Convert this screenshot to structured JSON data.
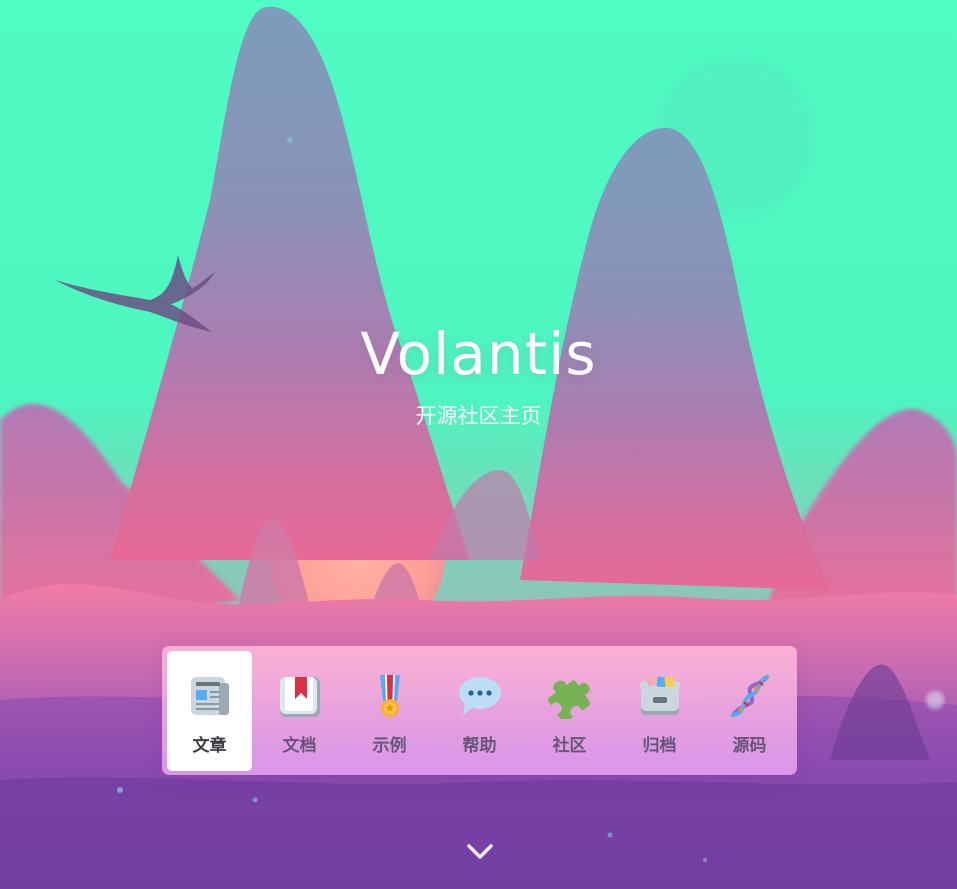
{
  "hero": {
    "title": "Volantis",
    "subtitle": "开源社区主页"
  },
  "nav": {
    "active_index": 0,
    "items": [
      {
        "label": "文章",
        "icon": "newspaper-icon"
      },
      {
        "label": "文档",
        "icon": "bookmark-book-icon"
      },
      {
        "label": "示例",
        "icon": "medal-icon"
      },
      {
        "label": "帮助",
        "icon": "speech-bubble-icon"
      },
      {
        "label": "社区",
        "icon": "puzzle-piece-icon"
      },
      {
        "label": "归档",
        "icon": "card-file-box-icon"
      },
      {
        "label": "源码",
        "icon": "dna-icon"
      }
    ]
  },
  "scroll_down": {
    "icon": "chevron-down-icon"
  },
  "colors": {
    "sky": "#4dfbc0",
    "mountain": "#8a8fb8",
    "sunset_pink": "#f07ca0",
    "ground_purple": "#7a3fa8",
    "text": "#ffffff"
  }
}
